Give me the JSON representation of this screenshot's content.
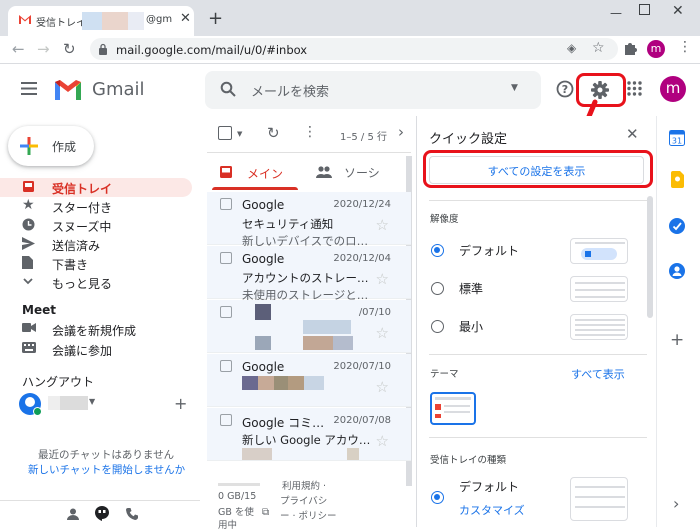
{
  "browser": {
    "tab_title": "受信トレイ - ",
    "tab_title_suffix": "@gm",
    "new_tab": "+",
    "url": "mail.google.com/mail/u/0/#inbox",
    "profile_initial": "m",
    "window_controls": [
      "minimize-icon",
      "restore-icon",
      "close-icon"
    ]
  },
  "header": {
    "logo_text": "Gmail",
    "search_placeholder": "メールを検索",
    "avatar_initial": "m"
  },
  "sidebar": {
    "compose_label": "作成",
    "items": [
      {
        "label": "受信トレイ",
        "icon": "inbox-icon",
        "active": true
      },
      {
        "label": "スター付き",
        "icon": "star-icon"
      },
      {
        "label": "スヌーズ中",
        "icon": "clock-icon"
      },
      {
        "label": "送信済み",
        "icon": "send-icon"
      },
      {
        "label": "下書き",
        "icon": "draft-icon"
      },
      {
        "label": "もっと見る",
        "icon": "chevron-down-icon"
      }
    ],
    "meet_title": "Meet",
    "meet_items": [
      {
        "label": "会議を新規作成",
        "icon": "video-icon"
      },
      {
        "label": "会議に参加",
        "icon": "keyboard-icon"
      }
    ],
    "hangouts_title": "ハングアウト",
    "hangouts_add": "+",
    "no_chats": "最近のチャットはありません",
    "start_chat_link": "新しいチャットを開始しませんか"
  },
  "list": {
    "pagination": "1–5 / 5 行",
    "tabs": [
      {
        "label": "メイン",
        "active": true
      },
      {
        "label": "ソーシ"
      }
    ],
    "rows": [
      {
        "sender": "Google",
        "date": "2020/12/24",
        "subject": "セキュリティ通知",
        "snippet": "新しいデバイスでのロ…"
      },
      {
        "sender": "Google",
        "date": "2020/12/04",
        "subject": "アカウントのストレー…",
        "snippet": "未使用のストレージと…"
      },
      {
        "sender": "",
        "date": "/07/10",
        "subject": "",
        "snippet": ""
      },
      {
        "sender": "Google",
        "date": "2020/07/10",
        "subject": "",
        "snippet": ""
      },
      {
        "sender": "Google コミ…",
        "date": "2020/07/08",
        "subject": "新しい Google アカウ…",
        "snippet": ""
      }
    ],
    "storage_line1": "0 GB/15",
    "storage_line2": "GB を使",
    "storage_line3": "用中",
    "terms": "利用規約 ·",
    "privacy": "プライバシ",
    "policy": "ー · ポリシー"
  },
  "quick_settings": {
    "title": "クイック設定",
    "see_all": "すべての設定を表示",
    "density_title": "解像度",
    "density_options": [
      {
        "label": "デフォルト",
        "selected": true
      },
      {
        "label": "標準",
        "selected": false
      },
      {
        "label": "最小",
        "selected": false
      }
    ],
    "theme_title": "テーマ",
    "theme_view_all": "すべて表示",
    "inbox_type_title": "受信トレイの種類",
    "inbox_type_options": [
      {
        "label": "デフォルト",
        "selected": true
      },
      {
        "label": "カスタマイズ",
        "link": true
      }
    ]
  },
  "colors": {
    "accent": "#1a73e8",
    "gmail_red": "#d93025",
    "highlight_red": "#e8121b",
    "active_bg": "#fce8e6",
    "profile": "#b0007f"
  }
}
